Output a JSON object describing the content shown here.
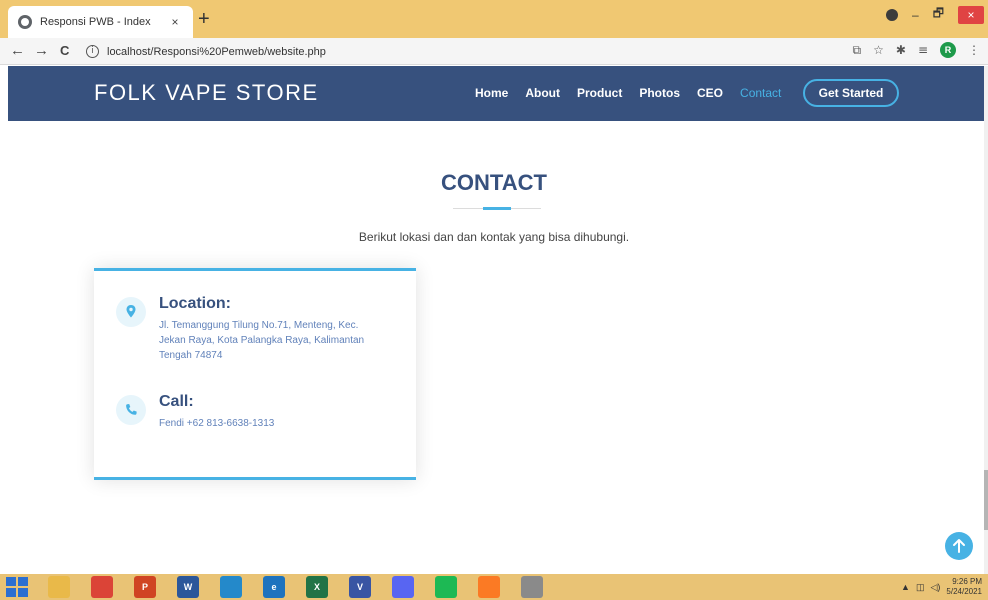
{
  "browser": {
    "tab_title": "Responsi PWB - Index",
    "tab_close": "×",
    "new_tab": "+",
    "url": "localhost/Responsi%20Pemweb/website.php",
    "avatar_letter": "R",
    "window_minimize": "–",
    "window_restore": "🗗",
    "window_close": "×",
    "back": "←",
    "forward": "→",
    "reload": "C",
    "info": "i",
    "extensions": {
      "translate": "⧉",
      "star": "☆",
      "puzzle": "✱",
      "menu_list": "≡"
    },
    "more": "⋮"
  },
  "site": {
    "logo": "FOLK VAPE STORE",
    "nav": [
      {
        "label": "Home"
      },
      {
        "label": "About"
      },
      {
        "label": "Product"
      },
      {
        "label": "Photos"
      },
      {
        "label": "CEO"
      },
      {
        "label": "Contact",
        "active": true
      }
    ],
    "cta": "Get Started"
  },
  "section": {
    "title": "CONTACT",
    "description": "Berikut lokasi dan dan kontak yang bisa dihubungi.",
    "location": {
      "heading": "Location:",
      "text": "Jl. Temanggung Tilung No.71, Menteng, Kec. Jekan Raya, Kota Palangka Raya, Kalimantan Tengah 74874"
    },
    "call": {
      "heading": "Call:",
      "text": "Fendi +62 813-6638-1313"
    }
  },
  "taskbar": {
    "apps": [
      {
        "name": "file-explorer",
        "label": "",
        "color": "#e9b949"
      },
      {
        "name": "chrome",
        "label": "",
        "color": "#db4437"
      },
      {
        "name": "powerpoint",
        "label": "P",
        "color": "#d04423"
      },
      {
        "name": "word",
        "label": "W",
        "color": "#2b579a"
      },
      {
        "name": "vscode",
        "label": "",
        "color": "#2489ca"
      },
      {
        "name": "edge",
        "label": "e",
        "color": "#1e73be"
      },
      {
        "name": "excel",
        "label": "X",
        "color": "#217346"
      },
      {
        "name": "visio",
        "label": "V",
        "color": "#3955a3"
      },
      {
        "name": "discord",
        "label": "",
        "color": "#5865f2"
      },
      {
        "name": "spotify",
        "label": "",
        "color": "#1db954"
      },
      {
        "name": "xampp",
        "label": "",
        "color": "#fb7a24"
      },
      {
        "name": "network-app",
        "label": "",
        "color": "#8a8a8a"
      }
    ],
    "time": "9:26 PM",
    "date": "5/24/2021"
  },
  "colors": {
    "header_bg": "#37517e",
    "accent": "#47b2e4",
    "tab_bar": "#f0c872",
    "taskbar": "#e9c375"
  }
}
